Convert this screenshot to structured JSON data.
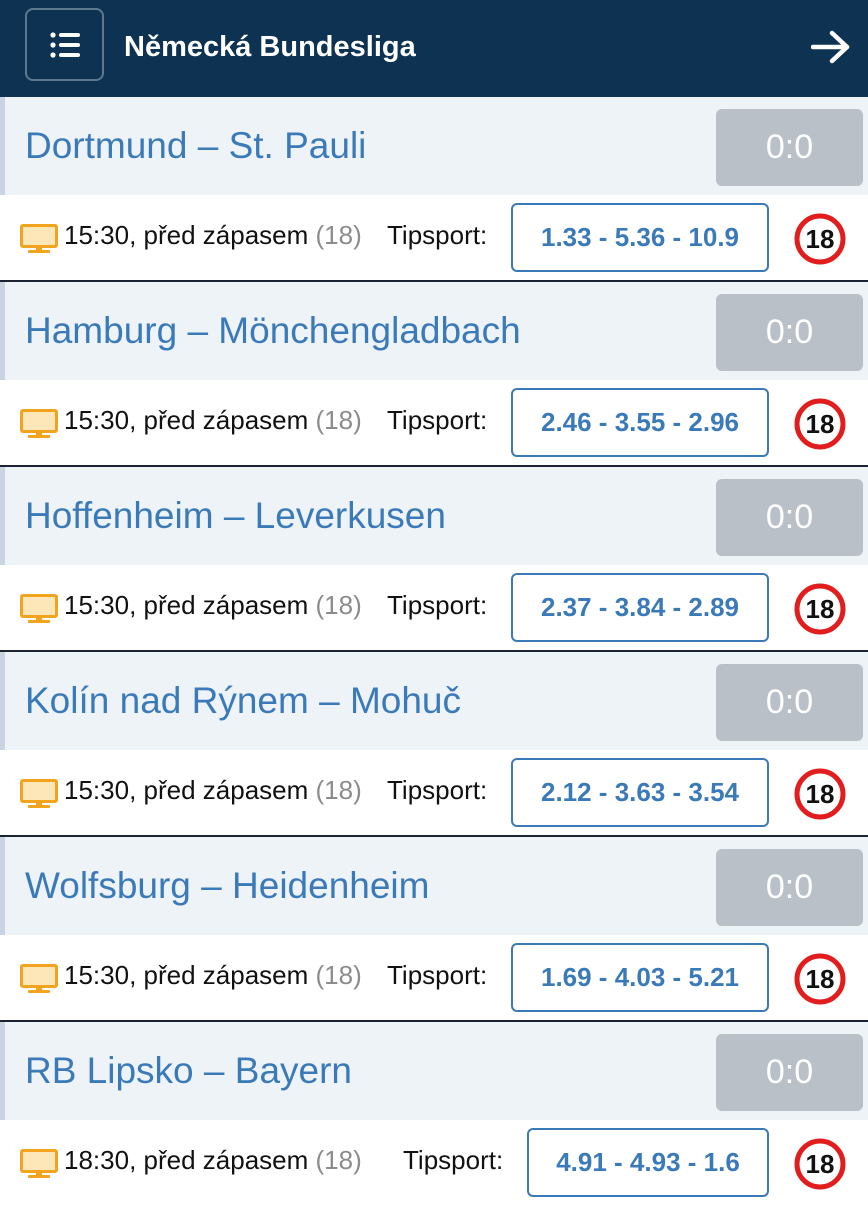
{
  "header": {
    "title": "Německá Bundesliga",
    "menu_icon": "list-icon",
    "forward_icon": "arrow-right-icon",
    "background": "#0e3352"
  },
  "colors": {
    "team_text": "#3b7ab8",
    "score_bg": "#b9c0c7",
    "tv_icon": "#f3a41f",
    "age_badge_ring": "#e11d1d"
  },
  "matches": [
    {
      "teams": "Dortmund – St. Pauli",
      "score": "0:0",
      "time": "15:30, před zápasem",
      "count": "(18)",
      "bookmaker": "Tipsport:",
      "odds": "1.33 - 5.36 - 10.9",
      "age_label": "18"
    },
    {
      "teams": "Hamburg – Mönchengladbach",
      "score": "0:0",
      "time": "15:30, před zápasem",
      "count": "(18)",
      "bookmaker": "Tipsport:",
      "odds": "2.46 - 3.55 - 2.96",
      "age_label": "18"
    },
    {
      "teams": "Hoffenheim – Leverkusen",
      "score": "0:0",
      "time": "15:30, před zápasem",
      "count": "(18)",
      "bookmaker": "Tipsport:",
      "odds": "2.37 - 3.84 - 2.89",
      "age_label": "18"
    },
    {
      "teams": "Kolín nad Rýnem – Mohuč",
      "score": "0:0",
      "time": "15:30, před zápasem",
      "count": "(18)",
      "bookmaker": "Tipsport:",
      "odds": "2.12 - 3.63 - 3.54",
      "age_label": "18"
    },
    {
      "teams": "Wolfsburg – Heidenheim",
      "score": "0:0",
      "time": "15:30, před zápasem",
      "count": "(18)",
      "bookmaker": "Tipsport:",
      "odds": "1.69 - 4.03 - 5.21",
      "age_label": "18"
    },
    {
      "teams": "RB Lipsko – Bayern",
      "score": "0:0",
      "time": "18:30, před zápasem",
      "count": "(18)",
      "bookmaker": "Tipsport:",
      "odds": "4.91 - 4.93 - 1.6",
      "age_label": "18"
    }
  ]
}
